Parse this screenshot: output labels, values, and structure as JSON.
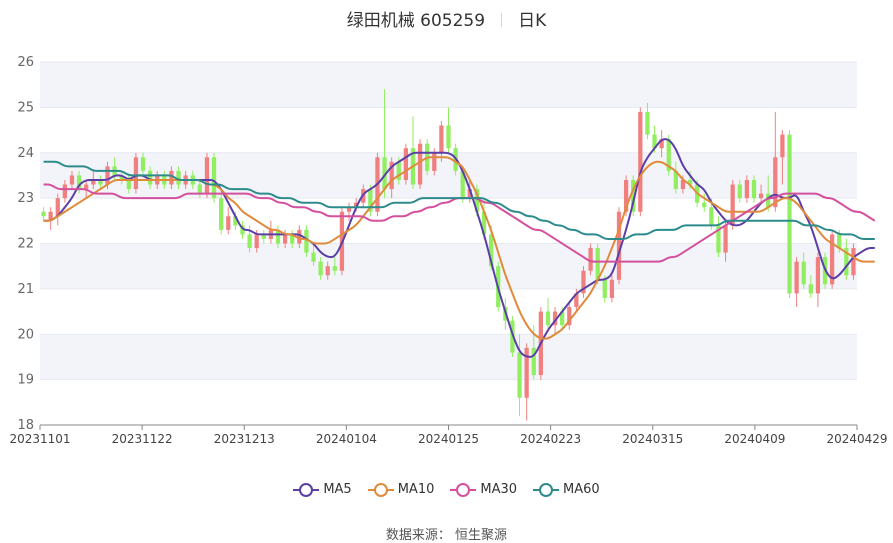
{
  "title": {
    "stock": "绿田机械 605259",
    "period": "日K"
  },
  "source": "数据来源： 恒生聚源",
  "chart_data": {
    "type": "candlestick",
    "y_ticks": [
      "26",
      "25",
      "24",
      "23",
      "22",
      "21",
      "20",
      "19",
      "18"
    ],
    "ylim": [
      18,
      26
    ],
    "x_tick_labels": [
      "20231101",
      "20231122",
      "20231213",
      "20240104",
      "20240125",
      "20240223",
      "20240315",
      "20240409",
      "20240429"
    ],
    "up_color": "#f08080",
    "down_color": "#90ee60",
    "candles": [
      {
        "o": 22.7,
        "h": 22.8,
        "l": 22.5,
        "c": 22.6
      },
      {
        "o": 22.5,
        "h": 22.8,
        "l": 22.3,
        "c": 22.7
      },
      {
        "o": 22.6,
        "h": 23.1,
        "l": 22.4,
        "c": 23.0
      },
      {
        "o": 23.0,
        "h": 23.4,
        "l": 22.9,
        "c": 23.3
      },
      {
        "o": 23.3,
        "h": 23.6,
        "l": 23.2,
        "c": 23.5
      },
      {
        "o": 23.5,
        "h": 23.6,
        "l": 23.1,
        "c": 23.2
      },
      {
        "o": 23.2,
        "h": 23.4,
        "l": 23.0,
        "c": 23.3
      },
      {
        "o": 23.3,
        "h": 23.6,
        "l": 23.2,
        "c": 23.4
      },
      {
        "o": 23.4,
        "h": 23.5,
        "l": 23.2,
        "c": 23.3
      },
      {
        "o": 23.3,
        "h": 23.8,
        "l": 23.2,
        "c": 23.7
      },
      {
        "o": 23.7,
        "h": 23.9,
        "l": 23.4,
        "c": 23.5
      },
      {
        "o": 23.5,
        "h": 23.6,
        "l": 23.3,
        "c": 23.4
      },
      {
        "o": 23.4,
        "h": 23.5,
        "l": 23.1,
        "c": 23.2
      },
      {
        "o": 23.2,
        "h": 24.0,
        "l": 23.1,
        "c": 23.9
      },
      {
        "o": 23.9,
        "h": 24.0,
        "l": 23.5,
        "c": 23.6
      },
      {
        "o": 23.6,
        "h": 23.7,
        "l": 23.2,
        "c": 23.3
      },
      {
        "o": 23.3,
        "h": 23.6,
        "l": 23.2,
        "c": 23.5
      },
      {
        "o": 23.5,
        "h": 23.6,
        "l": 23.2,
        "c": 23.3
      },
      {
        "o": 23.3,
        "h": 23.7,
        "l": 23.2,
        "c": 23.6
      },
      {
        "o": 23.6,
        "h": 23.7,
        "l": 23.2,
        "c": 23.3
      },
      {
        "o": 23.3,
        "h": 23.6,
        "l": 23.2,
        "c": 23.5
      },
      {
        "o": 23.5,
        "h": 23.6,
        "l": 23.2,
        "c": 23.3
      },
      {
        "o": 23.3,
        "h": 23.4,
        "l": 23.0,
        "c": 23.1
      },
      {
        "o": 23.1,
        "h": 24.0,
        "l": 23.0,
        "c": 23.9
      },
      {
        "o": 23.9,
        "h": 24.0,
        "l": 22.9,
        "c": 23.0
      },
      {
        "o": 23.0,
        "h": 23.1,
        "l": 22.2,
        "c": 22.3
      },
      {
        "o": 22.3,
        "h": 22.8,
        "l": 22.2,
        "c": 22.6
      },
      {
        "o": 22.6,
        "h": 22.7,
        "l": 22.3,
        "c": 22.4
      },
      {
        "o": 22.4,
        "h": 22.5,
        "l": 22.1,
        "c": 22.2
      },
      {
        "o": 22.2,
        "h": 22.4,
        "l": 21.8,
        "c": 21.9
      },
      {
        "o": 21.9,
        "h": 22.3,
        "l": 21.8,
        "c": 22.2
      },
      {
        "o": 22.2,
        "h": 22.3,
        "l": 22.0,
        "c": 22.1
      },
      {
        "o": 22.1,
        "h": 22.5,
        "l": 22.0,
        "c": 22.3
      },
      {
        "o": 22.3,
        "h": 22.4,
        "l": 21.9,
        "c": 22.0
      },
      {
        "o": 22.0,
        "h": 22.3,
        "l": 21.9,
        "c": 22.2
      },
      {
        "o": 22.2,
        "h": 22.3,
        "l": 21.9,
        "c": 22.0
      },
      {
        "o": 22.0,
        "h": 22.4,
        "l": 21.9,
        "c": 22.3
      },
      {
        "o": 22.3,
        "h": 22.4,
        "l": 21.7,
        "c": 21.8
      },
      {
        "o": 21.8,
        "h": 22.0,
        "l": 21.5,
        "c": 21.6
      },
      {
        "o": 21.6,
        "h": 21.7,
        "l": 21.2,
        "c": 21.3
      },
      {
        "o": 21.3,
        "h": 21.6,
        "l": 21.2,
        "c": 21.5
      },
      {
        "o": 21.5,
        "h": 21.7,
        "l": 21.3,
        "c": 21.4
      },
      {
        "o": 21.4,
        "h": 22.8,
        "l": 21.3,
        "c": 22.7
      },
      {
        "o": 22.7,
        "h": 22.9,
        "l": 22.5,
        "c": 22.8
      },
      {
        "o": 22.8,
        "h": 23.0,
        "l": 22.7,
        "c": 22.9
      },
      {
        "o": 22.9,
        "h": 23.3,
        "l": 22.8,
        "c": 23.2
      },
      {
        "o": 23.2,
        "h": 23.3,
        "l": 22.6,
        "c": 22.7
      },
      {
        "o": 22.7,
        "h": 24.0,
        "l": 22.6,
        "c": 23.9
      },
      {
        "o": 23.9,
        "h": 25.4,
        "l": 23.0,
        "c": 23.2
      },
      {
        "o": 23.2,
        "h": 23.9,
        "l": 23.0,
        "c": 23.8
      },
      {
        "o": 23.8,
        "h": 23.9,
        "l": 23.3,
        "c": 23.4
      },
      {
        "o": 23.4,
        "h": 24.2,
        "l": 23.3,
        "c": 24.1
      },
      {
        "o": 24.1,
        "h": 24.8,
        "l": 23.2,
        "c": 23.3
      },
      {
        "o": 23.3,
        "h": 24.3,
        "l": 23.2,
        "c": 24.2
      },
      {
        "o": 24.2,
        "h": 24.3,
        "l": 23.5,
        "c": 23.6
      },
      {
        "o": 23.6,
        "h": 24.1,
        "l": 23.5,
        "c": 24.0
      },
      {
        "o": 24.0,
        "h": 24.7,
        "l": 23.8,
        "c": 24.6
      },
      {
        "o": 24.6,
        "h": 25.0,
        "l": 24.0,
        "c": 24.1
      },
      {
        "o": 24.1,
        "h": 24.2,
        "l": 23.5,
        "c": 23.6
      },
      {
        "o": 23.6,
        "h": 23.7,
        "l": 22.9,
        "c": 23.0
      },
      {
        "o": 23.0,
        "h": 23.4,
        "l": 22.9,
        "c": 23.2
      },
      {
        "o": 23.2,
        "h": 23.3,
        "l": 22.6,
        "c": 22.7
      },
      {
        "o": 22.7,
        "h": 23.0,
        "l": 22.1,
        "c": 22.2
      },
      {
        "o": 22.2,
        "h": 22.4,
        "l": 21.4,
        "c": 21.5
      },
      {
        "o": 21.5,
        "h": 21.6,
        "l": 20.5,
        "c": 20.6
      },
      {
        "o": 20.6,
        "h": 20.8,
        "l": 20.1,
        "c": 20.3
      },
      {
        "o": 20.3,
        "h": 20.4,
        "l": 19.5,
        "c": 19.6
      },
      {
        "o": 19.6,
        "h": 20.0,
        "l": 18.2,
        "c": 18.6
      },
      {
        "o": 18.6,
        "h": 19.8,
        "l": 18.1,
        "c": 19.7
      },
      {
        "o": 19.7,
        "h": 20.2,
        "l": 19.0,
        "c": 19.1
      },
      {
        "o": 19.1,
        "h": 20.6,
        "l": 19.0,
        "c": 20.5
      },
      {
        "o": 20.5,
        "h": 20.8,
        "l": 20.1,
        "c": 20.2
      },
      {
        "o": 20.2,
        "h": 20.6,
        "l": 20.0,
        "c": 20.5
      },
      {
        "o": 20.5,
        "h": 20.6,
        "l": 20.1,
        "c": 20.2
      },
      {
        "o": 20.2,
        "h": 20.7,
        "l": 20.1,
        "c": 20.6
      },
      {
        "o": 20.6,
        "h": 21.0,
        "l": 20.5,
        "c": 20.9
      },
      {
        "o": 20.9,
        "h": 21.5,
        "l": 20.8,
        "c": 21.4
      },
      {
        "o": 21.4,
        "h": 22.0,
        "l": 21.3,
        "c": 21.9
      },
      {
        "o": 21.9,
        "h": 22.0,
        "l": 21.1,
        "c": 21.2
      },
      {
        "o": 21.2,
        "h": 21.3,
        "l": 20.7,
        "c": 20.8
      },
      {
        "o": 20.8,
        "h": 21.3,
        "l": 20.7,
        "c": 21.2
      },
      {
        "o": 21.2,
        "h": 22.8,
        "l": 21.1,
        "c": 22.7
      },
      {
        "o": 22.7,
        "h": 23.5,
        "l": 22.6,
        "c": 23.4
      },
      {
        "o": 23.4,
        "h": 23.5,
        "l": 22.6,
        "c": 22.7
      },
      {
        "o": 22.7,
        "h": 25.0,
        "l": 22.6,
        "c": 24.9
      },
      {
        "o": 24.9,
        "h": 25.1,
        "l": 24.3,
        "c": 24.4
      },
      {
        "o": 24.4,
        "h": 24.6,
        "l": 24.0,
        "c": 24.1
      },
      {
        "o": 24.1,
        "h": 24.5,
        "l": 23.9,
        "c": 24.3
      },
      {
        "o": 24.3,
        "h": 24.4,
        "l": 23.5,
        "c": 23.6
      },
      {
        "o": 23.6,
        "h": 23.8,
        "l": 23.1,
        "c": 23.2
      },
      {
        "o": 23.2,
        "h": 23.5,
        "l": 23.1,
        "c": 23.4
      },
      {
        "o": 23.4,
        "h": 23.6,
        "l": 23.2,
        "c": 23.3
      },
      {
        "o": 23.3,
        "h": 23.4,
        "l": 22.8,
        "c": 22.9
      },
      {
        "o": 22.9,
        "h": 23.1,
        "l": 22.7,
        "c": 22.8
      },
      {
        "o": 22.8,
        "h": 23.0,
        "l": 22.3,
        "c": 22.4
      },
      {
        "o": 22.4,
        "h": 22.6,
        "l": 21.7,
        "c": 21.8
      },
      {
        "o": 21.8,
        "h": 22.5,
        "l": 21.6,
        "c": 22.4
      },
      {
        "o": 22.4,
        "h": 23.4,
        "l": 22.3,
        "c": 23.3
      },
      {
        "o": 23.3,
        "h": 23.4,
        "l": 22.9,
        "c": 23.0
      },
      {
        "o": 23.0,
        "h": 23.5,
        "l": 22.9,
        "c": 23.4
      },
      {
        "o": 23.4,
        "h": 23.5,
        "l": 22.9,
        "c": 23.0
      },
      {
        "o": 23.0,
        "h": 23.3,
        "l": 22.9,
        "c": 23.1
      },
      {
        "o": 23.1,
        "h": 23.5,
        "l": 22.7,
        "c": 22.8
      },
      {
        "o": 22.8,
        "h": 24.9,
        "l": 22.7,
        "c": 23.9
      },
      {
        "o": 23.9,
        "h": 24.5,
        "l": 23.3,
        "c": 24.4
      },
      {
        "o": 24.4,
        "h": 24.5,
        "l": 20.8,
        "c": 20.9
      },
      {
        "o": 20.9,
        "h": 21.7,
        "l": 20.6,
        "c": 21.6
      },
      {
        "o": 21.6,
        "h": 21.8,
        "l": 21.0,
        "c": 21.1
      },
      {
        "o": 21.1,
        "h": 21.3,
        "l": 20.8,
        "c": 20.9
      },
      {
        "o": 20.9,
        "h": 21.8,
        "l": 20.6,
        "c": 21.7
      },
      {
        "o": 21.7,
        "h": 21.8,
        "l": 21.0,
        "c": 21.1
      },
      {
        "o": 21.1,
        "h": 22.3,
        "l": 21.0,
        "c": 22.2
      },
      {
        "o": 22.2,
        "h": 22.3,
        "l": 21.8,
        "c": 21.9
      },
      {
        "o": 21.9,
        "h": 22.1,
        "l": 21.2,
        "c": 21.3
      },
      {
        "o": 21.3,
        "h": 22.0,
        "l": 21.2,
        "c": 21.9
      }
    ],
    "series": [
      {
        "name": "MA5",
        "color": "#5b3ea6",
        "values": [
          22.5,
          22.5,
          22.6,
          22.8,
          23.0,
          23.3,
          23.4,
          23.4,
          23.4,
          23.4,
          23.5,
          23.5,
          23.4,
          23.5,
          23.5,
          23.4,
          23.4,
          23.4,
          23.4,
          23.4,
          23.4,
          23.4,
          23.4,
          23.4,
          23.4,
          23.2,
          22.9,
          22.6,
          22.3,
          22.3,
          22.2,
          22.2,
          22.2,
          22.2,
          22.2,
          22.2,
          22.2,
          22.1,
          22.0,
          21.8,
          21.7,
          21.7,
          22.0,
          22.4,
          22.8,
          23.1,
          23.2,
          23.3,
          23.5,
          23.7,
          23.8,
          23.9,
          24.0,
          24.0,
          24.0,
          24.0,
          24.0,
          24.0,
          23.9,
          23.6,
          23.2,
          22.7,
          22.2,
          21.6,
          21.0,
          20.5,
          20.0,
          19.6,
          19.5,
          19.5,
          19.8,
          20.1,
          20.3,
          20.5,
          20.7,
          20.9,
          21.0,
          21.1,
          21.2,
          21.2,
          21.3,
          21.8,
          22.3,
          22.9,
          23.6,
          23.9,
          24.1,
          24.3,
          24.3,
          24.1,
          23.7,
          23.5,
          23.3,
          23.2,
          22.9,
          22.7,
          22.5,
          22.4,
          22.4,
          22.5,
          22.7,
          22.9,
          23.0,
          23.1,
          23.0,
          23.0,
          23.1,
          22.7,
          22.4,
          21.9,
          21.4,
          21.2,
          21.3,
          21.5,
          21.7,
          21.8,
          21.9,
          21.9
        ]
      },
      {
        "name": "MA10",
        "color": "#e08a3c",
        "values": [
          22.5,
          22.5,
          22.6,
          22.7,
          22.8,
          22.9,
          23.0,
          23.1,
          23.2,
          23.3,
          23.4,
          23.4,
          23.4,
          23.4,
          23.4,
          23.4,
          23.4,
          23.4,
          23.4,
          23.4,
          23.4,
          23.4,
          23.4,
          23.3,
          23.3,
          23.2,
          23.0,
          22.9,
          22.7,
          22.6,
          22.5,
          22.4,
          22.3,
          22.3,
          22.2,
          22.2,
          22.1,
          22.1,
          22.0,
          22.0,
          22.0,
          22.1,
          22.2,
          22.3,
          22.4,
          22.6,
          22.8,
          23.0,
          23.2,
          23.4,
          23.5,
          23.6,
          23.7,
          23.8,
          23.9,
          23.9,
          23.9,
          23.9,
          23.8,
          23.7,
          23.4,
          23.1,
          22.7,
          22.3,
          21.8,
          21.3,
          20.9,
          20.5,
          20.2,
          20.0,
          19.9,
          19.9,
          20.0,
          20.1,
          20.3,
          20.5,
          20.7,
          20.9,
          21.2,
          21.5,
          21.9,
          22.3,
          22.8,
          23.2,
          23.5,
          23.7,
          23.8,
          23.8,
          23.7,
          23.6,
          23.4,
          23.3,
          23.1,
          23.0,
          22.9,
          22.8,
          22.7,
          22.7,
          22.7,
          22.7,
          22.7,
          22.7,
          22.8,
          22.9,
          23.0,
          23.0,
          22.9,
          22.7,
          22.5,
          22.3,
          22.1,
          22.0,
          21.9,
          21.8,
          21.7,
          21.6,
          21.6,
          21.6
        ]
      },
      {
        "name": "MA30",
        "color": "#d4509e",
        "values": [
          23.3,
          23.3,
          23.2,
          23.2,
          23.2,
          23.2,
          23.2,
          23.1,
          23.1,
          23.1,
          23.1,
          23.0,
          23.0,
          23.0,
          23.0,
          23.0,
          23.0,
          23.0,
          23.0,
          23.0,
          23.1,
          23.1,
          23.1,
          23.1,
          23.1,
          23.1,
          23.1,
          23.1,
          23.1,
          23.1,
          23.0,
          23.0,
          23.0,
          22.9,
          22.9,
          22.8,
          22.8,
          22.8,
          22.7,
          22.7,
          22.6,
          22.6,
          22.6,
          22.6,
          22.6,
          22.6,
          22.5,
          22.5,
          22.5,
          22.6,
          22.6,
          22.6,
          22.7,
          22.7,
          22.8,
          22.8,
          22.9,
          22.9,
          23.0,
          23.0,
          23.0,
          23.0,
          22.9,
          22.9,
          22.8,
          22.7,
          22.6,
          22.5,
          22.4,
          22.3,
          22.3,
          22.2,
          22.1,
          22.0,
          21.9,
          21.8,
          21.7,
          21.6,
          21.6,
          21.6,
          21.6,
          21.6,
          21.6,
          21.6,
          21.6,
          21.6,
          21.6,
          21.6,
          21.7,
          21.7,
          21.8,
          21.9,
          22.0,
          22.1,
          22.2,
          22.3,
          22.4,
          22.5,
          22.6,
          22.7,
          22.8,
          22.9,
          23.0,
          23.0,
          23.1,
          23.1,
          23.1,
          23.1,
          23.1,
          23.1,
          23.0,
          23.0,
          22.9,
          22.8,
          22.7,
          22.7,
          22.6,
          22.5
        ]
      },
      {
        "name": "MA60",
        "color": "#2e8b8b",
        "values": [
          23.8,
          23.8,
          23.8,
          23.7,
          23.7,
          23.7,
          23.7,
          23.6,
          23.6,
          23.6,
          23.6,
          23.6,
          23.5,
          23.5,
          23.5,
          23.5,
          23.5,
          23.5,
          23.5,
          23.4,
          23.4,
          23.4,
          23.4,
          23.3,
          23.3,
          23.3,
          23.2,
          23.2,
          23.2,
          23.2,
          23.1,
          23.1,
          23.1,
          23.0,
          23.0,
          23.0,
          22.9,
          22.9,
          22.9,
          22.9,
          22.8,
          22.8,
          22.8,
          22.8,
          22.8,
          22.8,
          22.8,
          22.8,
          22.8,
          22.9,
          22.9,
          22.9,
          22.9,
          23.0,
          23.0,
          23.0,
          23.0,
          23.0,
          23.0,
          23.0,
          23.0,
          23.0,
          23.0,
          22.9,
          22.9,
          22.8,
          22.7,
          22.7,
          22.6,
          22.6,
          22.5,
          22.5,
          22.4,
          22.4,
          22.3,
          22.3,
          22.2,
          22.2,
          22.2,
          22.1,
          22.1,
          22.1,
          22.1,
          22.2,
          22.2,
          22.2,
          22.3,
          22.3,
          22.3,
          22.3,
          22.4,
          22.4,
          22.4,
          22.4,
          22.4,
          22.4,
          22.5,
          22.5,
          22.5,
          22.5,
          22.5,
          22.5,
          22.5,
          22.5,
          22.5,
          22.5,
          22.5,
          22.4,
          22.4,
          22.4,
          22.3,
          22.3,
          22.2,
          22.2,
          22.2,
          22.1,
          22.1,
          22.1
        ]
      }
    ]
  }
}
